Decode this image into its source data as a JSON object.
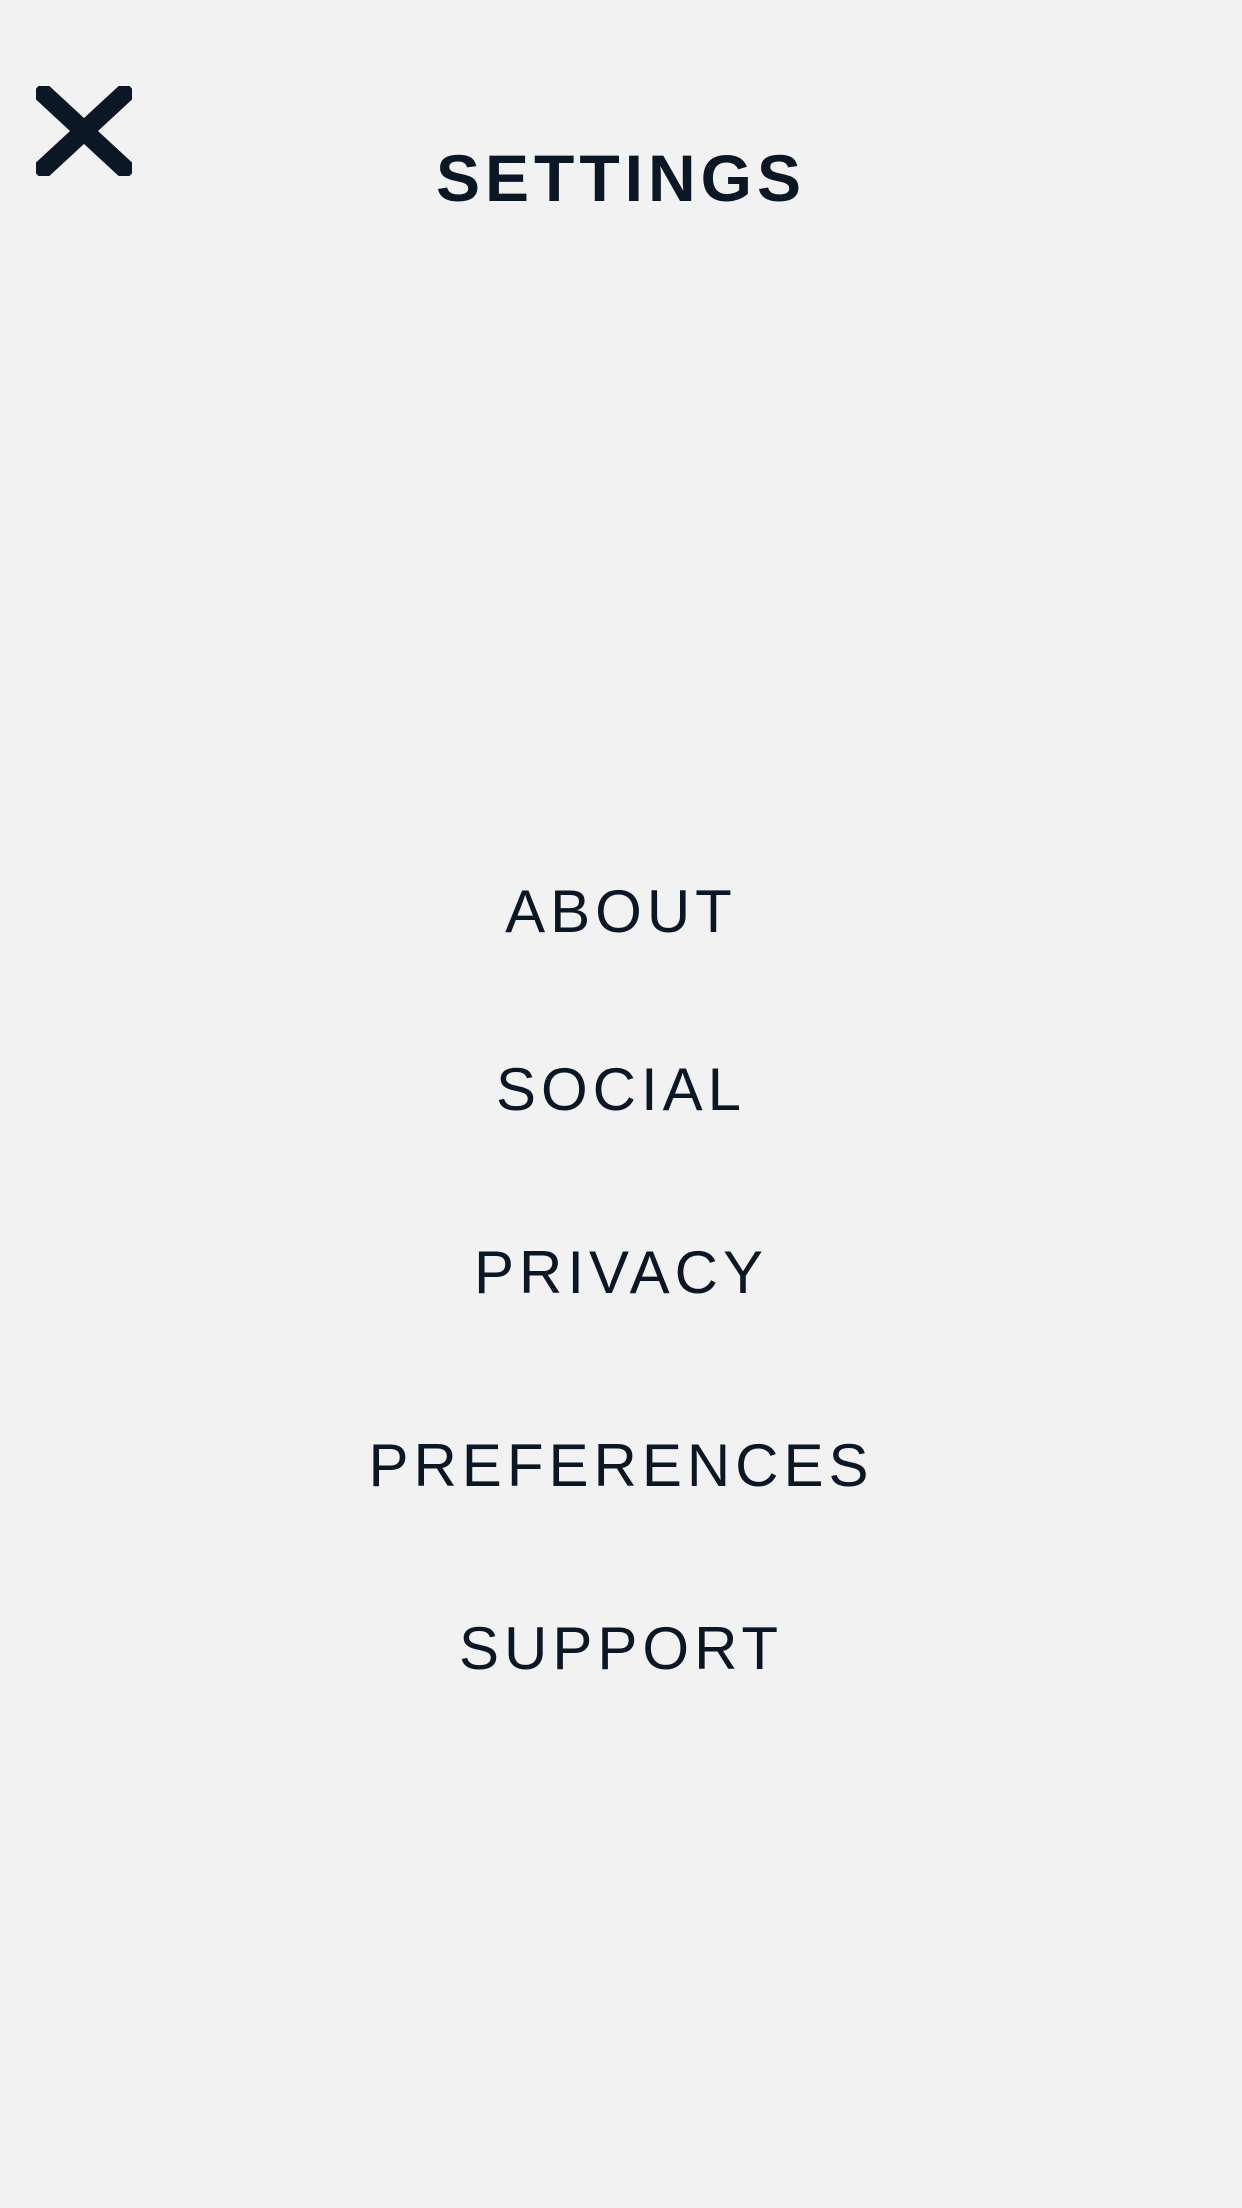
{
  "header": {
    "title": "SETTINGS",
    "close_icon": "close-icon"
  },
  "menu": {
    "items": [
      {
        "label": "ABOUT"
      },
      {
        "label": "SOCIAL"
      },
      {
        "label": "PRIVACY"
      },
      {
        "label": "PREFERENCES"
      },
      {
        "label": "SUPPORT"
      }
    ]
  },
  "colors": {
    "background": "#f2f2f3",
    "text": "#0c1726"
  }
}
